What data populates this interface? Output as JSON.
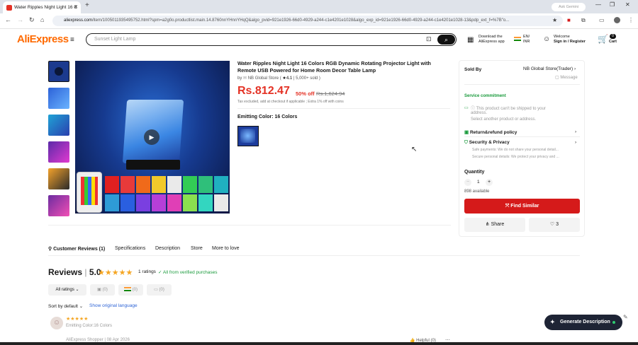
{
  "browser": {
    "tab_title": "Water Ripples Night Light 16 C",
    "ask_gemini": "Ask Gemini",
    "url_domain": "aliexpress.com",
    "url_path": "/item/1005011935495752.html?spm=a2g0o.productlist.main.14.8760nnYHnnYHqQ&algo_pvid=921e1926-66d0-4929-a244-c1e4201e1028&algo_exp_id=921e1926-66d0-4929-a244-c1e4201e1028-13&pdp_ext_f=%7B\"o..."
  },
  "header": {
    "logo_main": "AliExpress",
    "search_placeholder": "Sunset Light Lamp",
    "download_line1": "Download the",
    "download_line2": "AliExpress app",
    "lang_line1": "EN/",
    "lang_line2": "INR",
    "welcome": "Welcome",
    "signin": "Sign in / Register",
    "cart_label": "Cart",
    "cart_count": "0"
  },
  "product": {
    "title": "Water Ripples Night Light 16 Colors RGB Dynamic Rotating Projector Light with Remote USB Powered for Home Room Decor Table Lamp",
    "store_prefix": "by",
    "store_name": "NB Global Store",
    "rating": "4.1",
    "sold": "5,000+ sold",
    "price": "Rs.812.47",
    "discount": "50% off",
    "old_price": "Rs.1,624.94",
    "tax_note": "Tax excluded, add at checkout if applicable ; Extra 1% off with coins",
    "color_label": "Emitting Color: 16 Colors"
  },
  "side": {
    "sold_by_label": "Sold By",
    "seller": "NB Global Store(Trader)",
    "message": "Message",
    "service": "Service commitment",
    "ship_warning_1": "This product can't be shipped to your",
    "ship_warning_2": "address.",
    "ship_warning_3": "Select another product or address.",
    "return_policy": "Return&refund policy",
    "security": "Security & Privacy",
    "safe_pay": "Safe payments: We do not share your personal detail...",
    "secure_data": "Secure personal details: We protect your privacy and ...",
    "quantity_label": "Quantity",
    "quantity": "1",
    "available": "898 available",
    "find_similar": "Find Similar",
    "share": "Share",
    "likes": "3"
  },
  "tabs": [
    "Customer Reviews (1)",
    "Specifications",
    "Description",
    "Store",
    "More to love"
  ],
  "reviews": {
    "heading": "Reviews",
    "score": "5.0",
    "ratings": "1 ratings",
    "verified": "All from verified purchases",
    "filter_all": "All ratings",
    "chip_photo": "(0)",
    "chip_country": "(0)",
    "chip_comment": "(0)",
    "sort": "Sort by default",
    "original_lang": "Show original language",
    "review_color": "Emitting Color:16 Colors",
    "reviewer": "AliExpress Shopper | 08 Apr 2026",
    "helpful": "Helpful (0)"
  },
  "assistant": {
    "generate": "Generate Description"
  },
  "colors": {
    "brand_red": "#e43225",
    "button_red": "#d51a1a",
    "verified_green": "#1a9a3c",
    "star_gold": "#f5a623"
  }
}
